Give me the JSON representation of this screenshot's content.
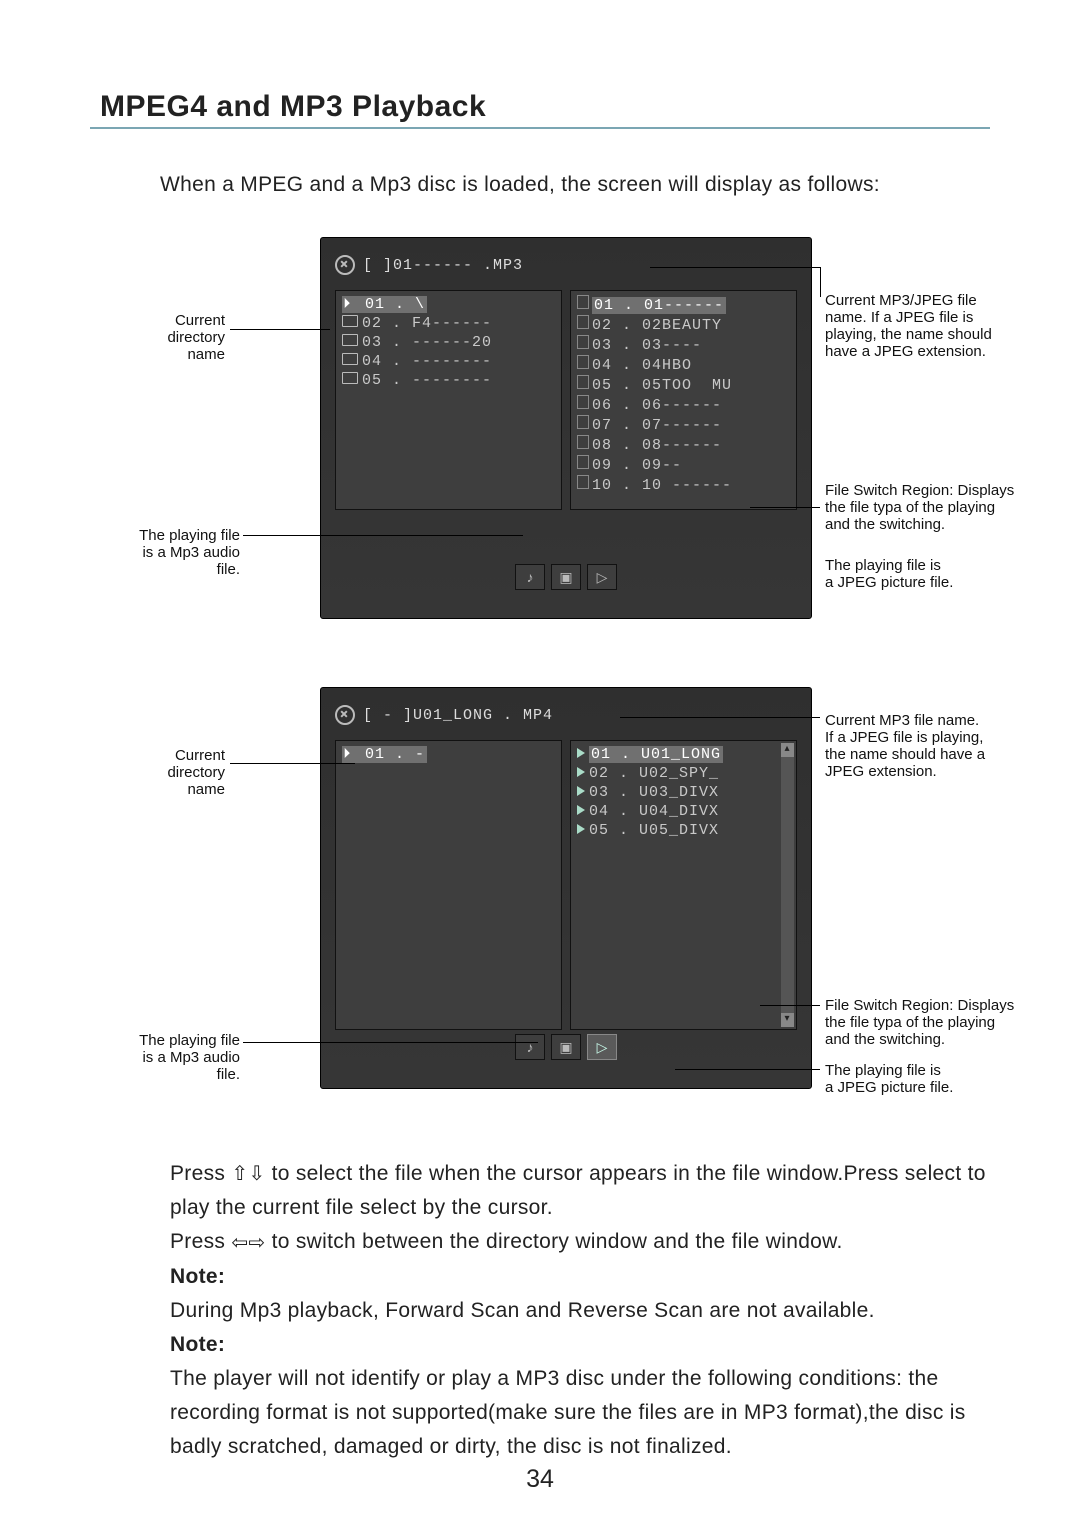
{
  "title": "MPEG4 and MP3 Playback",
  "intro": "When a MPEG and a Mp3 disc is loaded, the screen will display as follows:",
  "page_number": "34",
  "shot1": {
    "header": "[ ]01------ .MP3",
    "dirs": [
      "01 . \\",
      "02 . F4------",
      "03 . ------20",
      "04 . --------",
      "05 . --------"
    ],
    "files": [
      "01 . 01------",
      "02 . 02BEAUTY",
      "03 . 03----",
      "04 . 04HBO",
      "05 . 05TOO  MU",
      "06 . 06------",
      "07 . 07------",
      "08 . 08------",
      "09 . 09--",
      "10 . 10 ------"
    ]
  },
  "shot2": {
    "header": "[ - ]U01_LONG . MP4",
    "dirs": [
      "01 . -"
    ],
    "files": [
      "01 . U01_LONG",
      "02 . U02_SPY_",
      "03 . U03_DIVX",
      "04 . U04_DIVX",
      "05 . U05_DIVX"
    ]
  },
  "callouts": {
    "left_dir": "Current\ndirectory\nname",
    "left_play": "The playing file\nis a Mp3 audio\nfile.",
    "right_name1": "Current MP3/JPEG file\nname. If a JPEG file is\nplaying, the name should\nhave a JPEG extension.",
    "right_switch": "File Switch Region: Displays\nthe file typa of the playing\nand the switching.",
    "right_jpeg": "The playing file is\na JPEG picture file.",
    "right_name2": "Current MP3 file name.\nIf a JPEG file is playing,\nthe name should have a\nJPEG extension."
  },
  "instructions": {
    "p1a": "Press ",
    "p1b": " to select the file when the cursor appears in the file window.Press select to play the current file select by the cursor.",
    "p2a": "Press ",
    "p2b": " to switch between the directory window and the file window.",
    "note_label": "Note:",
    "note1": "During Mp3 playback, Forward Scan and Reverse Scan are not available.",
    "note2": "The player will not identify or play a MP3 disc under the following conditions: the recording format is not supported(make sure the files are in MP3 format),the disc is badly scratched, damaged or dirty, the disc is not finalized."
  }
}
